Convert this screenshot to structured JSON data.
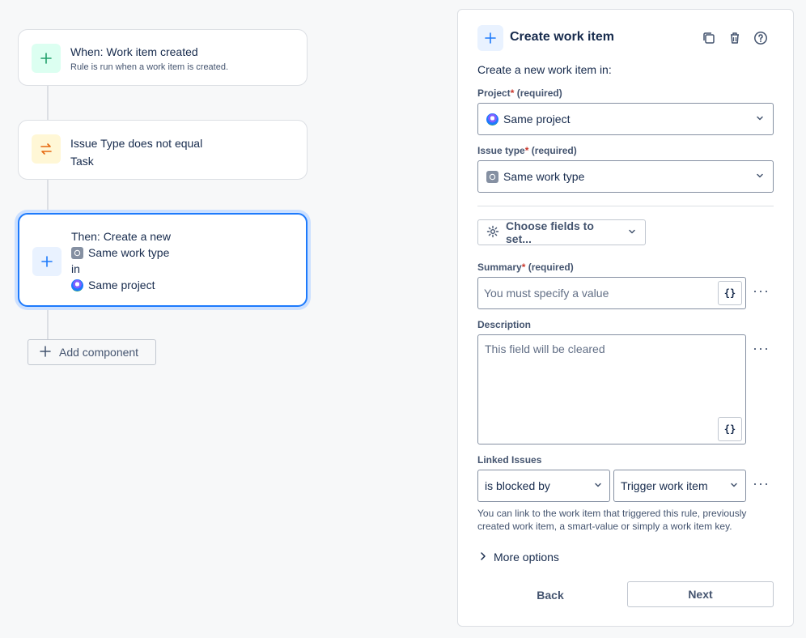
{
  "flow": {
    "trigger": {
      "title": "When: Work item created",
      "subtitle": "Rule is run when a work item is created.",
      "icon": "plus-icon",
      "accent": "#22a06b"
    },
    "condition": {
      "line1": "Issue Type does not equal",
      "line2": "Task",
      "icon": "swap-icon",
      "accent": "#e56910"
    },
    "action": {
      "line1": "Then: Create a new",
      "work_type": "Same work type",
      "connector": "in",
      "project": "Same project",
      "icon": "plus-icon",
      "accent": "#1d7afc"
    },
    "add_component": "Add component"
  },
  "panel": {
    "title": "Create work item",
    "intro": "Create a new work item in:",
    "project": {
      "label": "Project",
      "required_note": "(required)",
      "value": "Same project"
    },
    "issue_type": {
      "label": "Issue type",
      "required_note": "(required)",
      "value": "Same work type"
    },
    "choose_fields": "Choose fields to set...",
    "summary": {
      "label": "Summary",
      "required_note": "(required)",
      "placeholder": "You must specify a value",
      "smart_value": "{}"
    },
    "description": {
      "label": "Description",
      "placeholder": "This field will be cleared",
      "smart_value": "{}"
    },
    "linked_issues": {
      "label": "Linked Issues",
      "link_type": "is blocked by",
      "target": "Trigger work item",
      "help": "You can link to the work item that triggered this rule, previously created work item, a smart-value or simply a work item key."
    },
    "more_options": "More options",
    "back": "Back",
    "next": "Next",
    "required_marker": "*",
    "more_menu": "···"
  }
}
